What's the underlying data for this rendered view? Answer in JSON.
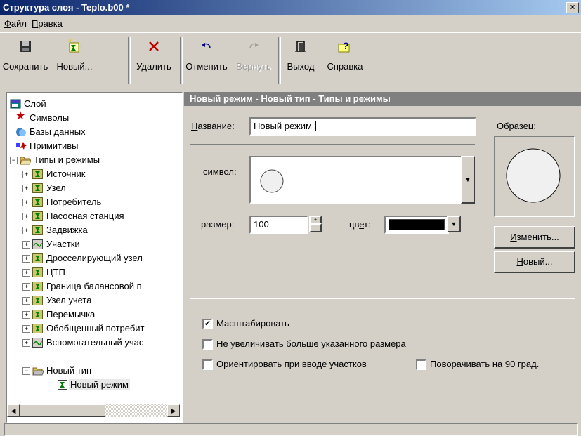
{
  "window": {
    "title": "Структура слоя - Teplo.b00 *",
    "close": "×"
  },
  "menu": [
    {
      "label": "Файл",
      "accel": "Ф",
      "rest": "айл"
    },
    {
      "label": "Правка",
      "accel": "П",
      "rest": "равка"
    }
  ],
  "toolbar": {
    "save": "Сохранить",
    "new": "Новый...",
    "delete": "Удалить",
    "undo": "Отменить",
    "redo": "Вернуть",
    "exit": "Выход",
    "help": "Справка"
  },
  "tree": {
    "root": "Слой",
    "items": [
      {
        "label": "Символы",
        "icon": "star-icon"
      },
      {
        "label": "Базы данных",
        "icon": "database-icon"
      },
      {
        "label": "Примитивы",
        "icon": "primitives-icon"
      },
      {
        "label": "Типы и режимы",
        "icon": "folder-open-icon"
      }
    ],
    "types": [
      "Источник",
      "Узел",
      "Потребитель",
      "Насосная станция",
      "Задвижка",
      "Участки",
      "Дросселирующий узел",
      "ЦТП",
      "Граница балансовой п",
      "Узел учета",
      "Перемычка",
      "Обобщенный потребит",
      "Вспомогательный учас"
    ],
    "new_type": "Новый тип",
    "new_mode": "Новый режим"
  },
  "panel": {
    "header": "Новый режим - Новый тип - Типы и режимы",
    "name_label": "Название:",
    "name_value": "Новый режим",
    "sample_label": "Образец:",
    "symbol_label": "символ:",
    "size_label": "размер:",
    "size_value": "100",
    "color_label": "цвет:",
    "color_value": "#000000",
    "change_button": "Изменить...",
    "new_button": "Новый..."
  },
  "options": {
    "scale": {
      "label": "Масштабировать",
      "checked": true
    },
    "no_enlarge": {
      "label": "Не увеличивать больше указанного размера",
      "checked": false
    },
    "orient": {
      "label": "Ориентировать при вводе участков",
      "checked": false
    },
    "rotate90": {
      "label": "Поворачивать на 90 град.",
      "checked": false
    }
  }
}
